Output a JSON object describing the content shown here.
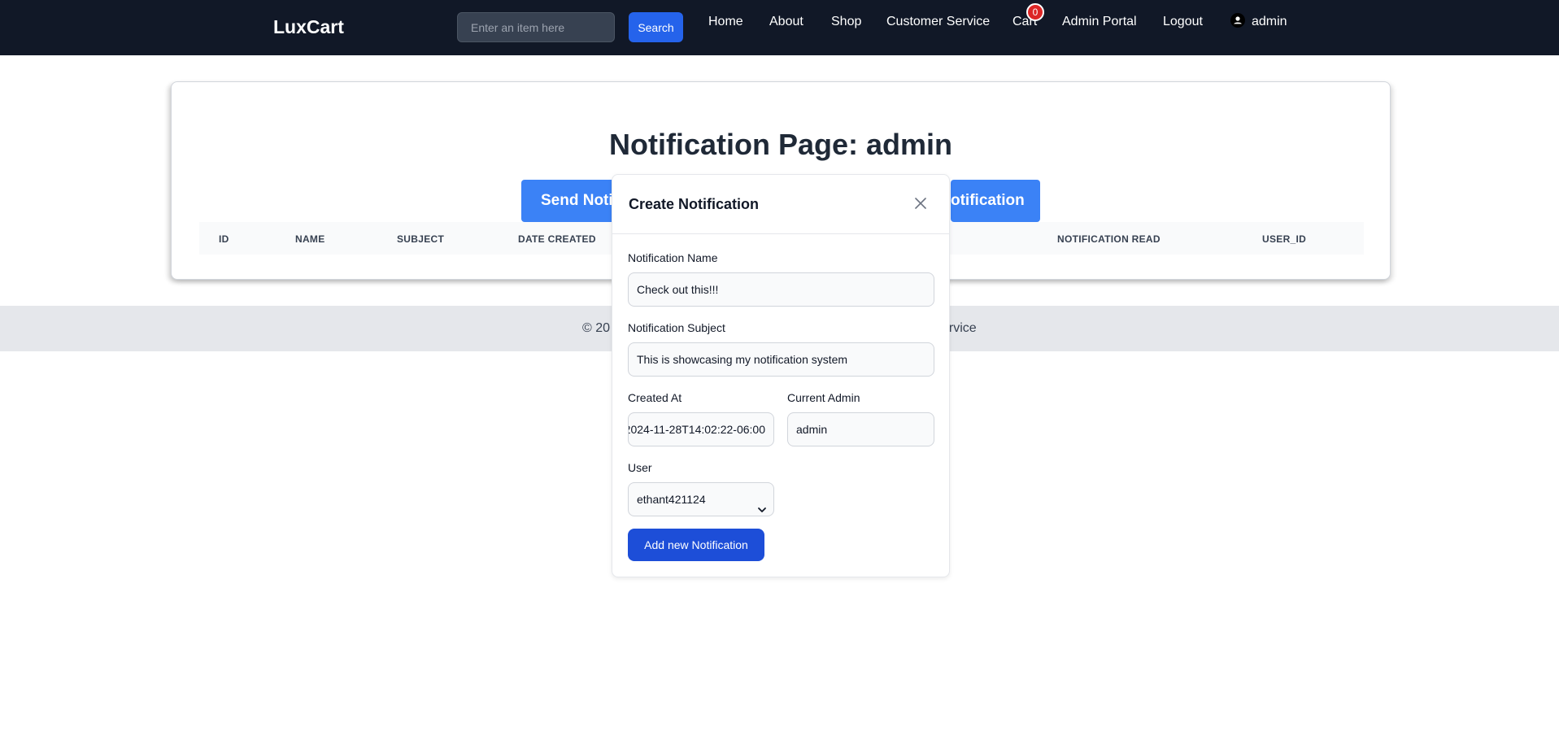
{
  "navbar": {
    "brand": "LuxCart",
    "search_placeholder": "Enter an item here",
    "search_label": "Search",
    "links": {
      "home": "Home",
      "about": "About",
      "shop": "Shop",
      "customer_service": "Customer Service",
      "cart": "Cart",
      "admin_portal": "Admin Portal",
      "logout": "Logout",
      "user": "admin"
    },
    "cart_count": "0"
  },
  "main": {
    "title": "Notification Page: admin",
    "send_button_label": "Send Notif",
    "create_button_label": "otification",
    "table_headers": {
      "id": "ID",
      "name": "NAME",
      "subject": "SUBJECT",
      "date_created": "DATE CREATED",
      "notification_read": "NOTIFICATION READ",
      "user_id": "USER_ID"
    }
  },
  "footer": {
    "left_text": "© 20",
    "right_text": "ervice"
  },
  "modal": {
    "title": "Create Notification",
    "name_label": "Notification Name",
    "name_value": "Check out this!!!",
    "subject_label": "Notification Subject",
    "subject_value": "This is showcasing my notification system",
    "created_label": "Created At",
    "created_value": "2024-11-28T14:02:22-06:00",
    "admin_label": "Current Admin",
    "admin_value": "admin",
    "user_label": "User",
    "user_value": "ethant421124",
    "submit_label": "Add new Notification"
  },
  "colors": {
    "navbar_bg": "#111827",
    "primary_button": "#2563eb",
    "big_button": "#3b82f6",
    "submit_button": "#1d4ed8",
    "badge": "#dc2626",
    "footer_bg": "#e5e7eb"
  },
  "icons": {
    "user": "user-icon",
    "close": "close-icon",
    "select_arrow": "chevron-down-icon"
  }
}
